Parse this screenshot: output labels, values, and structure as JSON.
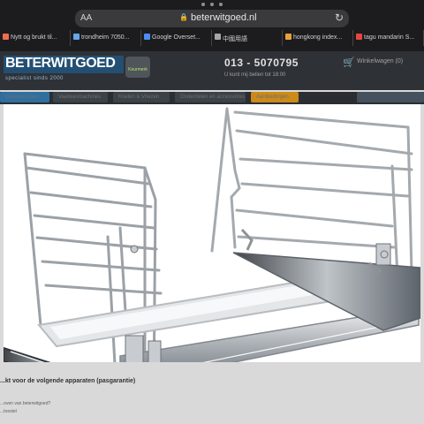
{
  "browser": {
    "text_size_label": "AA",
    "domain": "beterwitgoed.nl",
    "tabs": [
      {
        "label": "Nytt og brukt til...",
        "color": "#f06d4f"
      },
      {
        "label": "trondheim 7050...",
        "color": "#64a8e8"
      },
      {
        "label": "Google Overset...",
        "color": "#4b8cf0"
      },
      {
        "label": "中國用語",
        "color": "#a7a7a7"
      },
      {
        "label": "hongkong index...",
        "color": "#e8a138"
      },
      {
        "label": "tagu mandarin S...",
        "color": "#e94442"
      }
    ]
  },
  "site": {
    "logo": "BETERWITGOED",
    "logo_subtext": "specialist sinds 2000",
    "logo_badge": "Keurmerk",
    "phone": "013 - 5070795",
    "phone_subtext": "U kunt mij bellen tot 18:00",
    "cart": "Winkelwagen (0)",
    "nav": [
      "Wasmachines",
      "Vaatwasmachines",
      "Koelen & Vriezen",
      "Onderdelen en accessoires",
      "Aanbiedingen"
    ],
    "section_heading": "...kt voor de volgende apparaten (pasgarantie)",
    "lines": [
      "...oven van beterwitgoed?",
      "...toestel"
    ]
  }
}
